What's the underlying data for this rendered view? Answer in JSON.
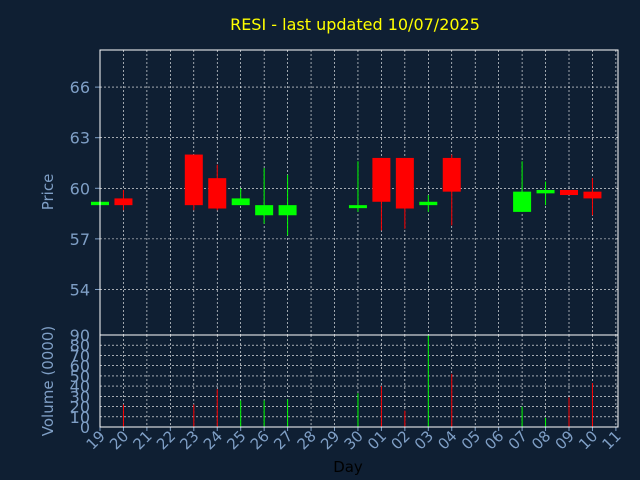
{
  "chart_data": {
    "type": "candlestick",
    "title": "RESI - last updated 10/07/2025",
    "xlabel": "Day",
    "colors": {
      "background": "#0f1f33",
      "axis_text": "#7f9fc6",
      "title": "#ffff00",
      "frame": "#ffffff",
      "grid": "#ffffff",
      "up": "#00ff00",
      "down": "#ff0000"
    },
    "x_ticks": [
      "19",
      "20",
      "21",
      "22",
      "23",
      "24",
      "25",
      "26",
      "27",
      "28",
      "29",
      "30",
      "01",
      "02",
      "03",
      "04",
      "05",
      "06",
      "07",
      "08",
      "09",
      "10",
      "11"
    ],
    "price_panel": {
      "ylabel": "Price",
      "ylim": [
        51.3,
        68.2
      ],
      "yticks": [
        54,
        57,
        60,
        63,
        66
      ],
      "grid": true
    },
    "volume_panel": {
      "ylabel": "Volume (0000)",
      "ylim": [
        0,
        90
      ],
      "yticks": [
        0,
        10,
        20,
        30,
        40,
        50,
        60,
        70,
        80,
        90
      ],
      "grid": true
    },
    "candles": [
      {
        "x": "19",
        "open": 59.0,
        "close": 59.2,
        "high": 59.2,
        "low": 59.0,
        "volume": 0
      },
      {
        "x": "20",
        "open": 59.4,
        "close": 59.0,
        "high": 59.9,
        "low": 58.7,
        "volume": 22
      },
      {
        "x": "23",
        "open": 62.0,
        "close": 59.0,
        "high": 62.0,
        "low": 58.7,
        "volume": 22
      },
      {
        "x": "24",
        "open": 60.6,
        "close": 58.8,
        "high": 61.4,
        "low": 58.7,
        "volume": 37
      },
      {
        "x": "25",
        "open": 59.0,
        "close": 59.4,
        "high": 60.0,
        "low": 59.0,
        "volume": 26
      },
      {
        "x": "26",
        "open": 58.4,
        "close": 59.0,
        "high": 61.2,
        "low": 57.9,
        "volume": 26
      },
      {
        "x": "27",
        "open": 58.4,
        "close": 59.0,
        "high": 60.8,
        "low": 57.2,
        "volume": 27
      },
      {
        "x": "30",
        "open": 58.9,
        "close": 59.0,
        "high": 61.6,
        "low": 58.6,
        "volume": 33
      },
      {
        "x": "01",
        "open": 61.8,
        "close": 59.2,
        "high": 61.8,
        "low": 57.5,
        "volume": 40
      },
      {
        "x": "02",
        "open": 61.8,
        "close": 58.8,
        "high": 61.8,
        "low": 57.6,
        "volume": 16
      },
      {
        "x": "03",
        "open": 59.0,
        "close": 59.2,
        "high": 59.6,
        "low": 58.6,
        "volume": 90
      },
      {
        "x": "04",
        "open": 61.8,
        "close": 59.8,
        "high": 62.0,
        "low": 57.8,
        "volume": 52
      },
      {
        "x": "07",
        "open": 58.6,
        "close": 59.8,
        "high": 61.6,
        "low": 58.6,
        "volume": 20
      },
      {
        "x": "08",
        "open": 59.7,
        "close": 59.9,
        "high": 60.4,
        "low": 59.0,
        "volume": 9
      },
      {
        "x": "09",
        "open": 59.9,
        "close": 59.6,
        "high": 59.9,
        "low": 59.6,
        "volume": 29
      },
      {
        "x": "10",
        "open": 59.8,
        "close": 59.4,
        "high": 60.6,
        "low": 58.4,
        "volume": 43
      }
    ]
  }
}
